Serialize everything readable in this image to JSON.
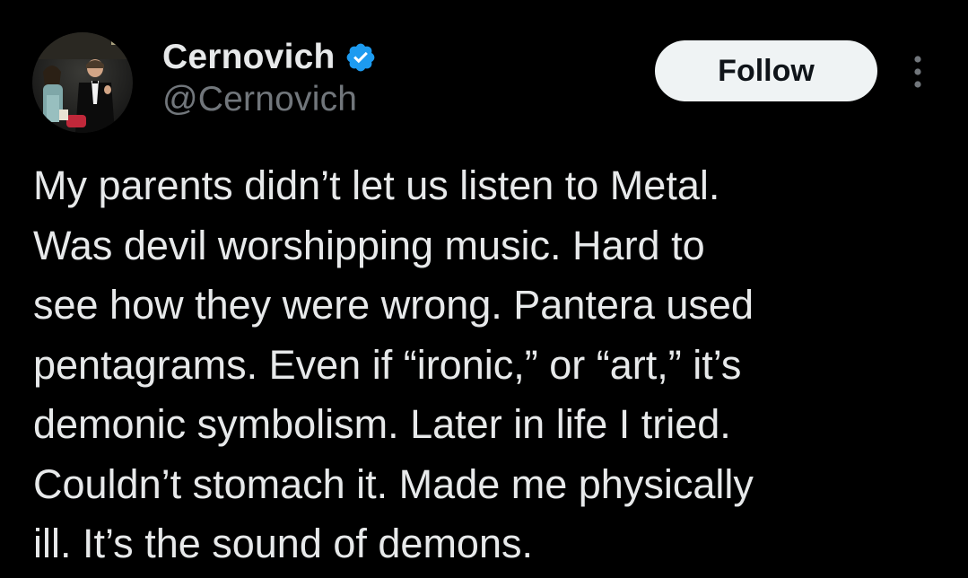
{
  "author": {
    "name": "Cernovich",
    "handle": "@Cernovich",
    "verified": true,
    "verified_badge_icon": "verified-badge-icon",
    "verified_badge_color": "#1d9bf0"
  },
  "actions": {
    "follow_label": "Follow",
    "more_icon": "more-options-icon"
  },
  "tweet": {
    "lines": [
      "My parents didn’t let us listen to Metal.",
      "Was devil worshipping music. Hard to",
      "see how they were wrong. Pantera used",
      "pentagrams. Even if “ironic,” or “art,” it’s",
      "demonic symbolism. Later in life I tried.",
      "Couldn’t stomach it. Made me physically",
      "ill. It’s the sound of demons."
    ]
  },
  "theme": {
    "background": "#000000",
    "primary_text": "#e7e9ea",
    "secondary_text": "#71767b",
    "follow_button_bg": "#eff3f4",
    "follow_button_text": "#0f1419"
  }
}
